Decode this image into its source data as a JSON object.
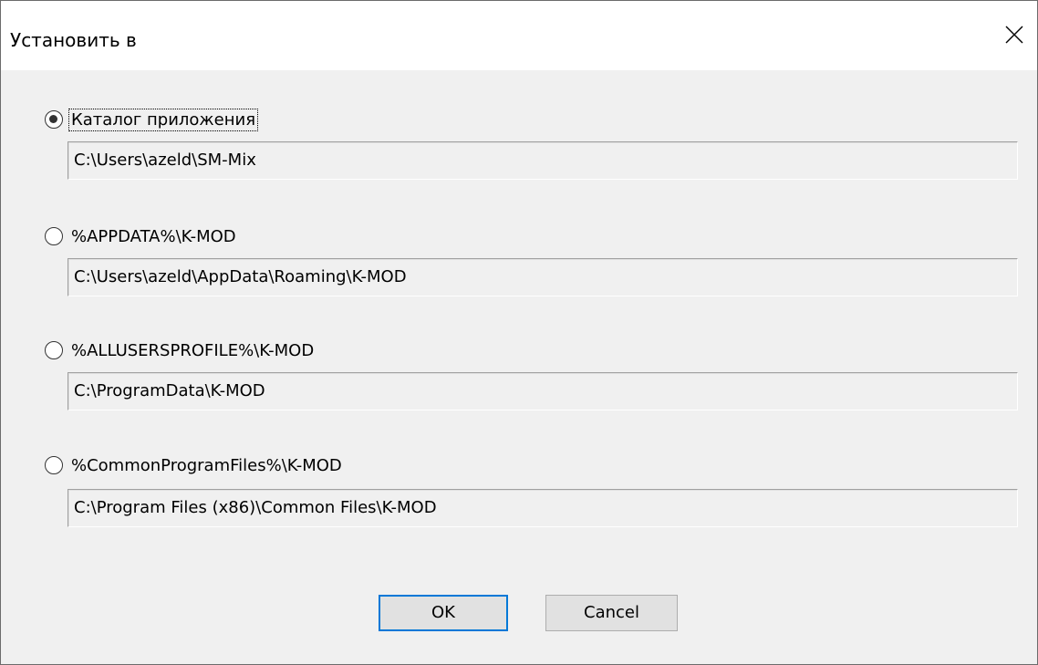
{
  "dialog": {
    "title": "Установить в",
    "close_icon": "close-icon"
  },
  "options": [
    {
      "label": "Каталог приложения",
      "path": "C:\\Users\\azeld\\SM-Mix",
      "checked": true
    },
    {
      "label": "%APPDATA%\\K-MOD",
      "path": "C:\\Users\\azeld\\AppData\\Roaming\\K-MOD",
      "checked": false
    },
    {
      "label": "%ALLUSERSPROFILE%\\K-MOD",
      "path": "C:\\ProgramData\\K-MOD",
      "checked": false
    },
    {
      "label": "%CommonProgramFiles%\\K-MOD",
      "path": "C:\\Program Files (x86)\\Common Files\\K-MOD",
      "checked": false
    }
  ],
  "buttons": {
    "ok_label": "OK",
    "cancel_label": "Cancel"
  },
  "colors": {
    "default_button_border": "#0078d7",
    "background": "#f0f0f0"
  }
}
